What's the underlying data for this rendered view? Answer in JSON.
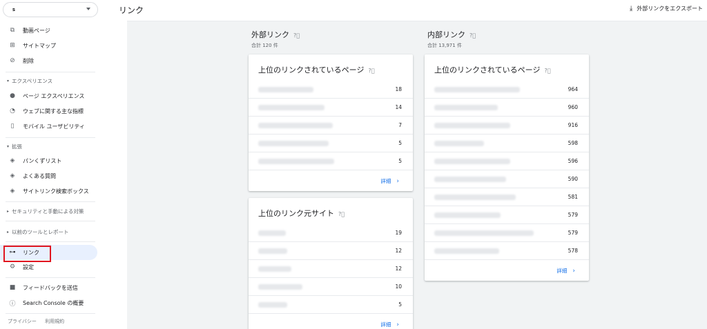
{
  "sidebar": {
    "property": {
      "favicon": "s",
      "value": ""
    },
    "items_top": [
      {
        "icon": "video-page-icon",
        "label": "動画ページ"
      },
      {
        "icon": "sitemap-icon",
        "label": "サイトマップ"
      },
      {
        "icon": "removal-icon",
        "label": "削除"
      }
    ],
    "section_experience": "エクスペリエンス",
    "items_experience": [
      {
        "icon": "page-experience-icon",
        "label": "ページ エクスペリエンス"
      },
      {
        "icon": "web-vitals-icon",
        "label": "ウェブに関する主な指標"
      },
      {
        "icon": "mobile-icon",
        "label": "モバイル ユーザビリティ"
      }
    ],
    "section_enhancements": "拡張",
    "items_enhancements": [
      {
        "icon": "breadcrumb-icon",
        "label": "パンくずリスト"
      },
      {
        "icon": "faq-icon",
        "label": "よくある質問"
      },
      {
        "icon": "sitelinks-icon",
        "label": "サイトリンク検索ボックス"
      }
    ],
    "section_security": "セキュリティと手動による対策",
    "section_legacy": "以前のツールとレポート",
    "items_bottom": [
      {
        "icon": "links-icon",
        "label": "リンク"
      },
      {
        "icon": "settings-icon",
        "label": "設定"
      }
    ],
    "items_footer": [
      {
        "icon": "feedback-icon",
        "label": "フィードバックを送信"
      },
      {
        "icon": "info-icon",
        "label": "Search Console の概要"
      }
    ],
    "privacy": "プライバシー",
    "terms": "利用規約"
  },
  "header": {
    "title": "リンク",
    "export_label": "外部リンクをエクスポート"
  },
  "external": {
    "title": "外部リンク",
    "total": "合計 120 件",
    "top_pages": {
      "title": "上位のリンクされているページ",
      "rows": [
        {
          "value": "18"
        },
        {
          "value": "14"
        },
        {
          "value": "7"
        },
        {
          "value": "5"
        },
        {
          "value": "5"
        }
      ],
      "more": "詳細"
    },
    "top_sites": {
      "title": "上位のリンク元サイト",
      "rows": [
        {
          "value": "19"
        },
        {
          "value": "12"
        },
        {
          "value": "12"
        },
        {
          "value": "10"
        },
        {
          "value": "5"
        }
      ],
      "more": "詳細"
    }
  },
  "internal": {
    "title": "内部リンク",
    "total": "合計 13,971 件",
    "top_pages": {
      "title": "上位のリンクされているページ",
      "rows": [
        {
          "value": "964"
        },
        {
          "value": "960"
        },
        {
          "value": "916"
        },
        {
          "value": "598"
        },
        {
          "value": "596"
        },
        {
          "value": "590"
        },
        {
          "value": "581"
        },
        {
          "value": "579"
        },
        {
          "value": "579"
        },
        {
          "value": "578"
        }
      ],
      "more": "詳細"
    }
  },
  "colors": {
    "accent": "#1a73e8",
    "active_bg": "#e8f0fe",
    "highlight": "#e0151f",
    "main_bg": "#f1f3f4"
  }
}
